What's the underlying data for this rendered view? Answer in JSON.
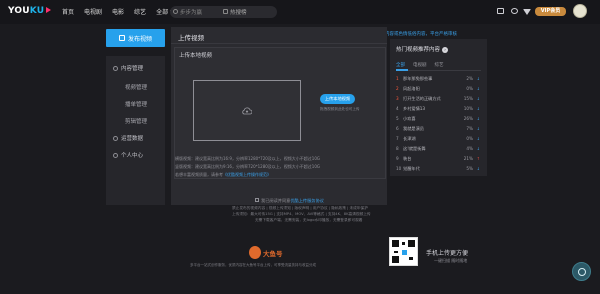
{
  "header": {
    "logo_text_a": "YOU",
    "logo_text_b": "KU",
    "nav": [
      "首页",
      "电视剧",
      "电影",
      "综艺"
    ],
    "all_label": "全部",
    "search_placeholder": "步步为赢",
    "hot_label": "热搜榜",
    "vip_label": "VIP会员",
    "accent": "#27a1ec",
    "brand_pink": "#ff2f6e"
  },
  "notice": "严禁上传侵权内容或色情低俗内容，平台严格审核",
  "sidebar": {
    "publish_label": "发布视频",
    "groups": [
      {
        "label": "内容管理",
        "icon": "content-icon"
      },
      {
        "label": "视频管理",
        "icon": ""
      },
      {
        "label": "播单管理",
        "icon": ""
      },
      {
        "label": "剪辑管理",
        "icon": ""
      },
      {
        "label": "运营数据",
        "icon": "data-icon"
      },
      {
        "label": "个人中心",
        "icon": "user-icon"
      }
    ]
  },
  "main": {
    "title": "上传视频",
    "box_title": "上传本地视频",
    "upload_button": "上传本地视频",
    "upload_hint": "拖拽视频到此处也可上传",
    "rules": [
      "横版视频：建议宽高比例为16:9，分辨率1280*720及以上，视频大小不超过10G",
      "竖版视频：建议宽高比例为9:16，分辨率720*1280及以上，视频大小不超过10G",
      "若想丰富视频质量，请参考"
    ],
    "rules_link": "《优酷视频上传操作规范》"
  },
  "hot": {
    "title": "热门视频推荐内容",
    "tabs": [
      "全部",
      "电视剧",
      "综艺"
    ],
    "active_tab": 0,
    "items": [
      {
        "rank": "1",
        "title": "那年那兔那些事",
        "pct": "2%",
        "dir": "down"
      },
      {
        "rank": "2",
        "title": "风起洛阳",
        "pct": "0%",
        "dir": "down"
      },
      {
        "rank": "3",
        "title": "打开生活的正确方式",
        "pct": "15%",
        "dir": "down"
      },
      {
        "rank": "4",
        "title": "乡村爱情13",
        "pct": "10%",
        "dir": "down"
      },
      {
        "rank": "5",
        "title": "小欢喜",
        "pct": "26%",
        "dir": "down"
      },
      {
        "rank": "6",
        "title": "我就是演员",
        "pct": "7%",
        "dir": "down"
      },
      {
        "rank": "7",
        "title": "长津湖",
        "pct": "0%",
        "dir": "down"
      },
      {
        "rank": "8",
        "title": "这!就是街舞",
        "pct": "4%",
        "dir": "down"
      },
      {
        "rank": "9",
        "title": "装台",
        "pct": "21%",
        "dir": "up"
      },
      {
        "rank": "10",
        "title": "觉醒年代",
        "pct": "5%",
        "dir": "down"
      }
    ]
  },
  "footer": {
    "agree_text": "我已阅读并同意",
    "agree_link": "优酷上传服务协议",
    "lines": [
      "禁止发布的视频内容 | 视频上传须知 | 版权声明 | 用户协议 | 隐私政策 | 未成年保护",
      "上传须知：最大可传15G | 支持MP4、MOV、AVI等格式 | 支持4K、8K高清视频上传",
      "无需下载客户端，无需安装，无logo水印播放，无需登录即可观看"
    ],
    "brand": "大鱼号",
    "brand_desc": "多平台一站式创作服务，优质内容在大鱼号平台上传，可享受流量扶持与收益分成",
    "qr_title": "手机上传更方便",
    "qr_sub": "一键扫描 随时随地"
  }
}
